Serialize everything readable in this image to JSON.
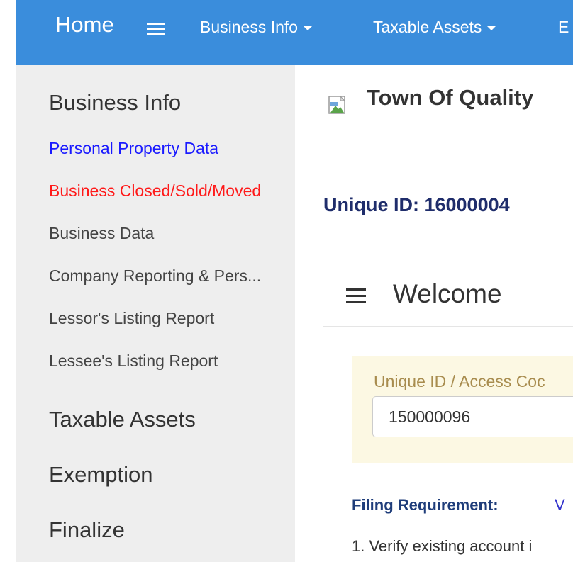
{
  "nav": {
    "home_label": "Home",
    "items": [
      {
        "label": "Business Info"
      },
      {
        "label": "Taxable Assets"
      },
      {
        "label": "E"
      }
    ]
  },
  "sidebar": {
    "sections": [
      {
        "title": "Business Info",
        "items": [
          {
            "label": "Personal Property Data",
            "color": "#1a1aff"
          },
          {
            "label": "Business Closed/Sold/Moved",
            "color": "#ff1a1a"
          },
          {
            "label": "Business Data",
            "color": "#444444"
          },
          {
            "label": "Company Reporting & Pers...",
            "color": "#444444"
          },
          {
            "label": "Lessor's Listing Report",
            "color": "#444444"
          },
          {
            "label": "Lessee's Listing Report",
            "color": "#444444"
          }
        ]
      },
      {
        "title": "Taxable Assets"
      },
      {
        "title": "Exemption"
      },
      {
        "title": "Finalize"
      }
    ]
  },
  "main": {
    "town_title": "Town Of Quality",
    "unique_id_heading": "Unique ID: 16000004",
    "welcome_title": "Welcome",
    "access": {
      "label": "Unique ID / Access Coc",
      "value": "150000096"
    },
    "filing_label": "Filing Requirement:",
    "filing_link": "V",
    "instruction_line": "1. Verify existing account i"
  },
  "colors": {
    "nav_bg": "#3a8ddc",
    "sidebar_bg": "#eeeeee",
    "active_link": "#1a1aff",
    "warning_link": "#ff1a1a",
    "heading_navy": "#1f2d6b",
    "panel_bg": "#fcf8e3"
  }
}
